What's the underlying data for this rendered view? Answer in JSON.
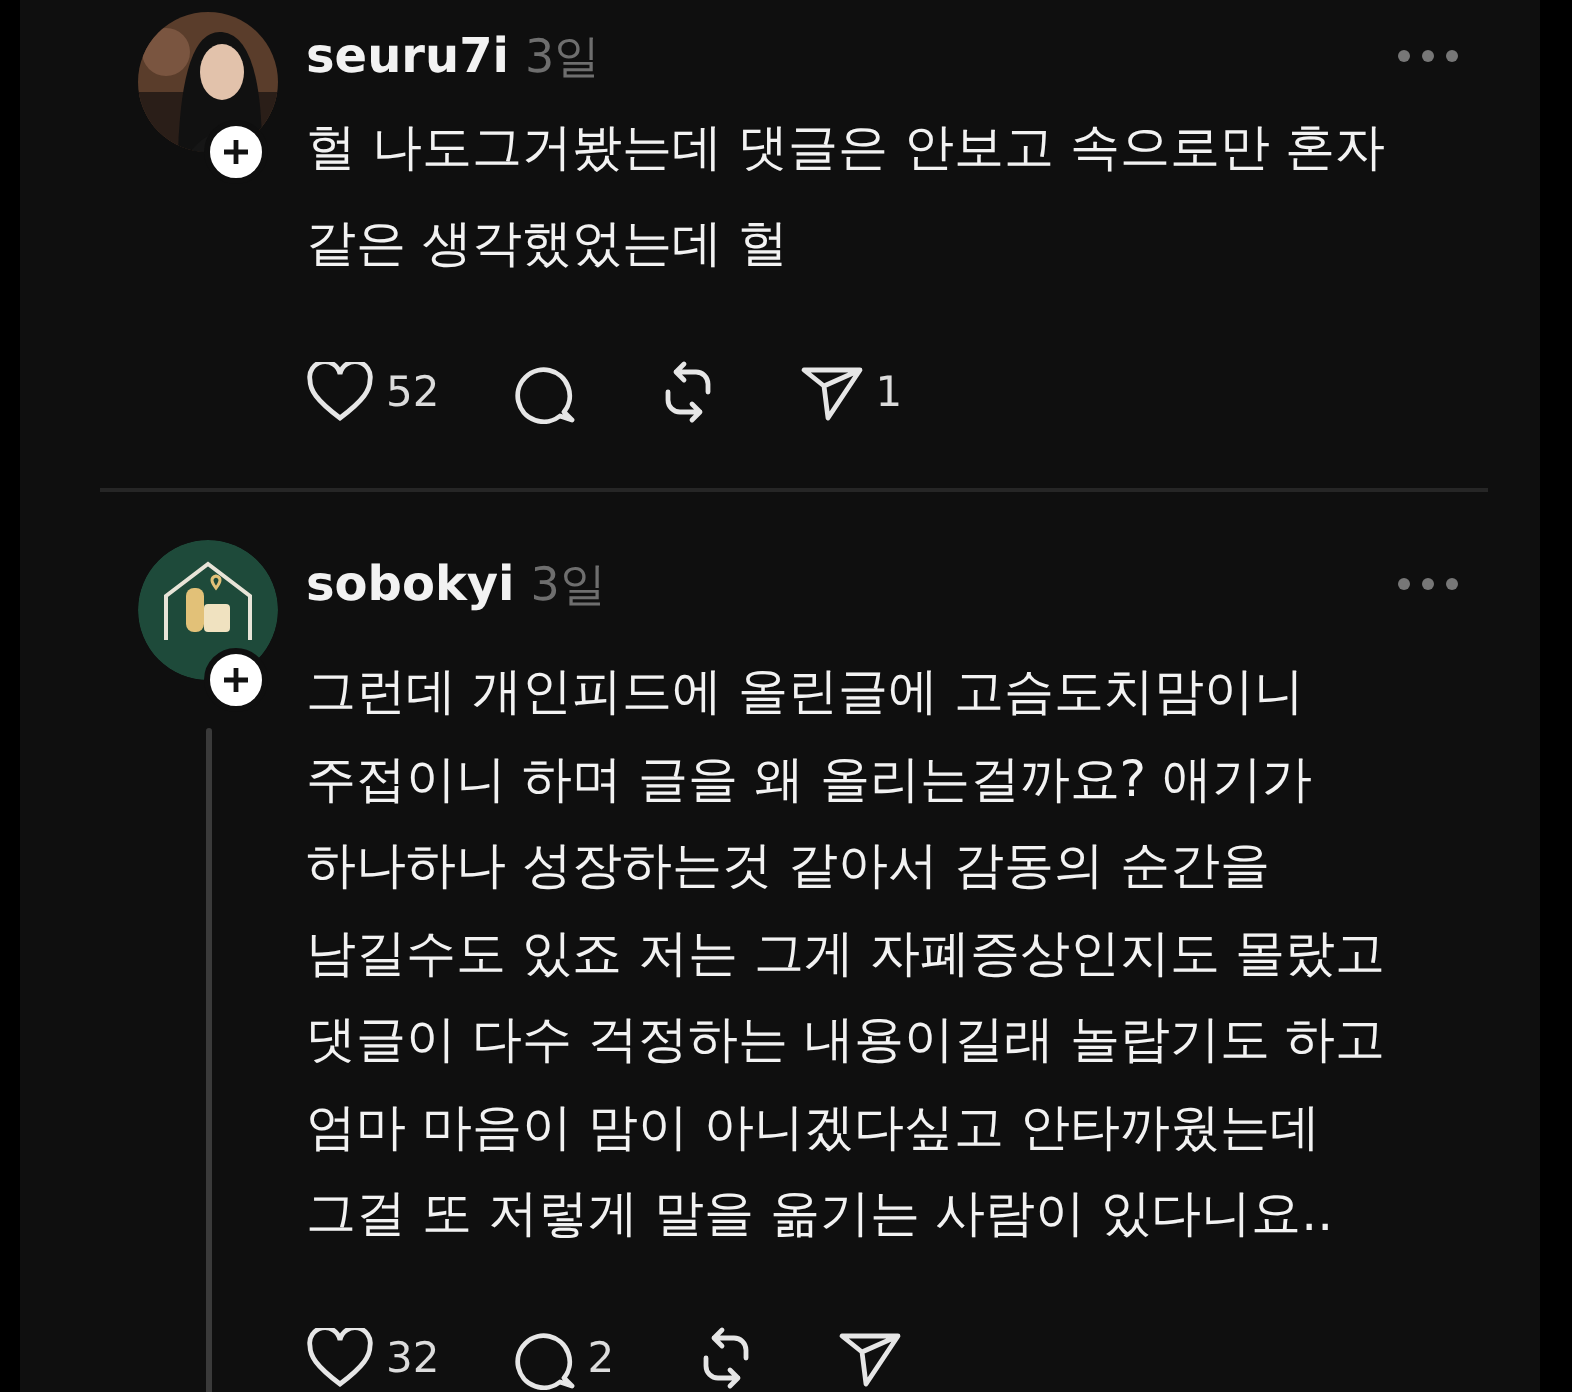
{
  "posts": [
    {
      "username": "seuru7i",
      "time": "3일",
      "text": "헐 나도그거봤는데 댓글은 안보고 속으로만 혼자\n같은 생각했었는데 헐",
      "thread": false,
      "actions": {
        "likes": "52",
        "shares": "1"
      }
    },
    {
      "avatar": {
        "kind": "logo"
      },
      "username": "sobokyi",
      "time": "3일",
      "text": "그런데 개인피드에 올린글에 고슴도치맘이니\n주접이니 하며 글을 왜 올리는걸까요? 애기가\n하나하나 성장하는것 같아서 감동의 순간을\n남길수도 있죠 저는 그게 자폐증상인지도 몰랐고\n댓글이 다수 걱정하는 내용이길래 놀랍기도 하고\n엄마 마음이 맘이 아니겠다싶고 안타까웠는데\n그걸 또 저렇게 말을 옮기는 사람이 있다니요..",
      "thread": true,
      "actions": {
        "likes": "32",
        "replies": "2"
      }
    }
  ]
}
